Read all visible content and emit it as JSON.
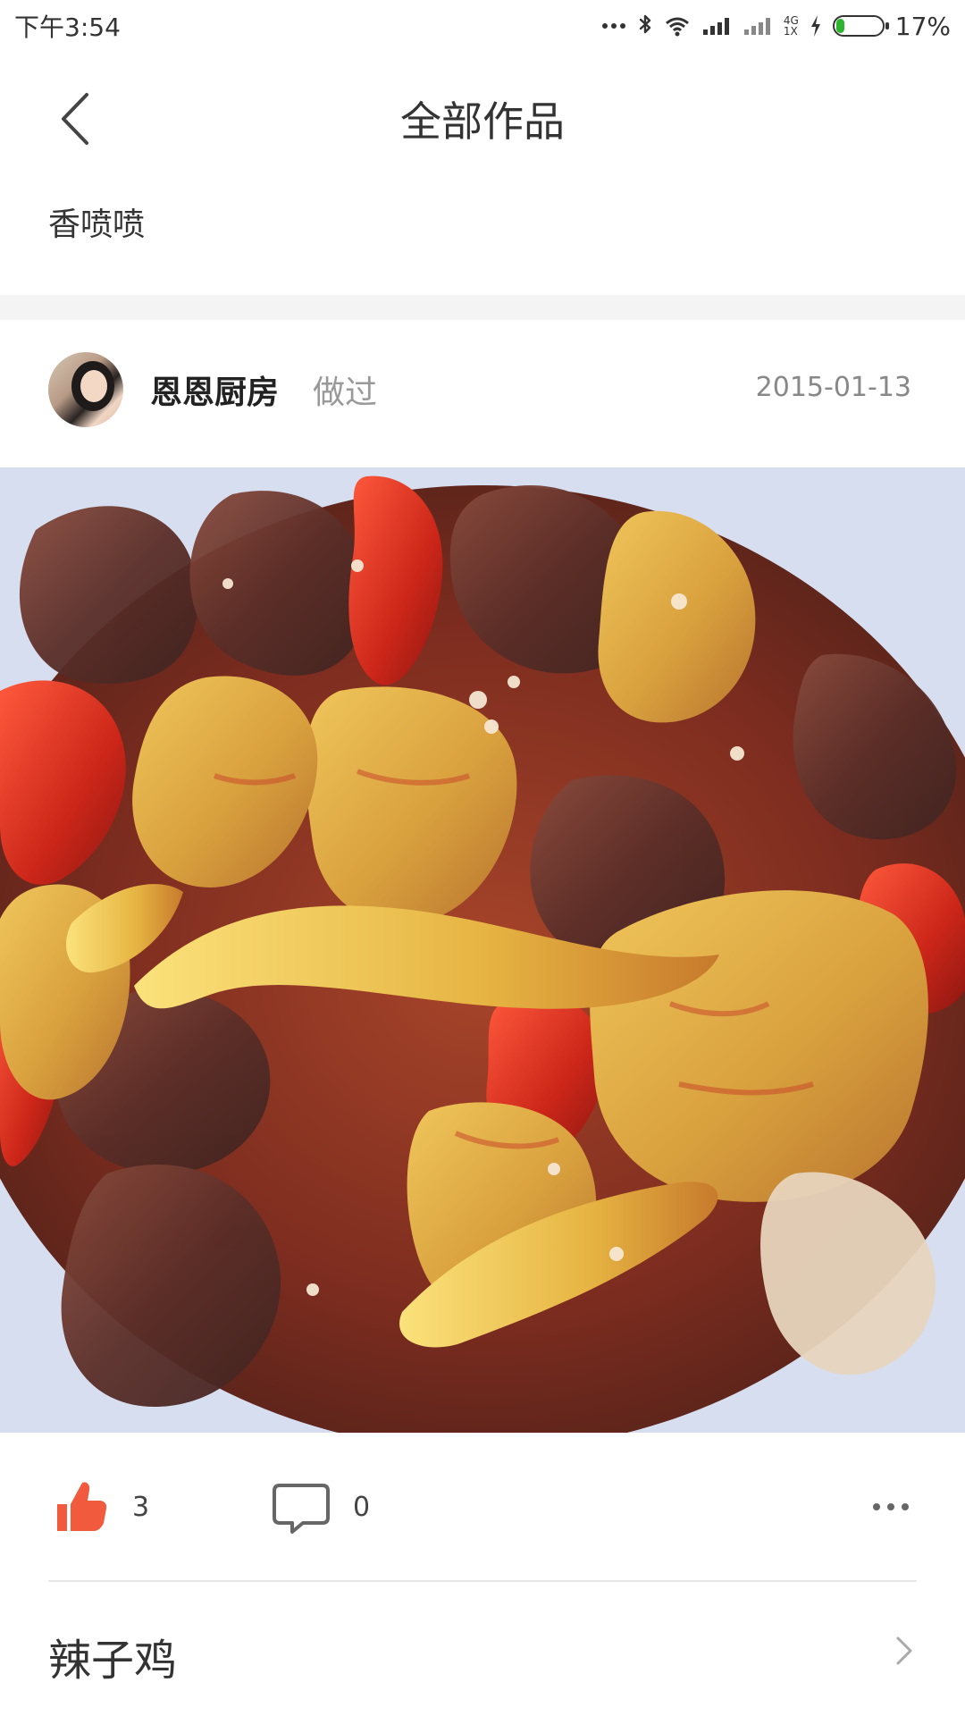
{
  "status_bar": {
    "time": "下午3:54",
    "network_label_top": "4G",
    "network_label_bottom": "1X",
    "battery_percent_text": "17%",
    "battery_level": 0.17
  },
  "header": {
    "title": "全部作品"
  },
  "subtitle": "香喷喷",
  "post": {
    "author_name": "恩恩厨房",
    "action": "做过",
    "date": "2015-01-13",
    "like_count": "3",
    "comment_count": "0"
  },
  "recipe": {
    "name": "辣子鸡"
  },
  "colors": {
    "like_icon": "#f15a3c",
    "text_dark": "#333333",
    "text_gray": "#999999",
    "divider": "#e7e7e7",
    "section_gap": "#f4f4f4",
    "battery_fill": "#2db52d"
  },
  "icons": {
    "back": "back-arrow-icon",
    "like": "thumbs-up-icon",
    "comment": "comment-icon",
    "more": "more-icon",
    "chevron": "chevron-right-icon"
  }
}
